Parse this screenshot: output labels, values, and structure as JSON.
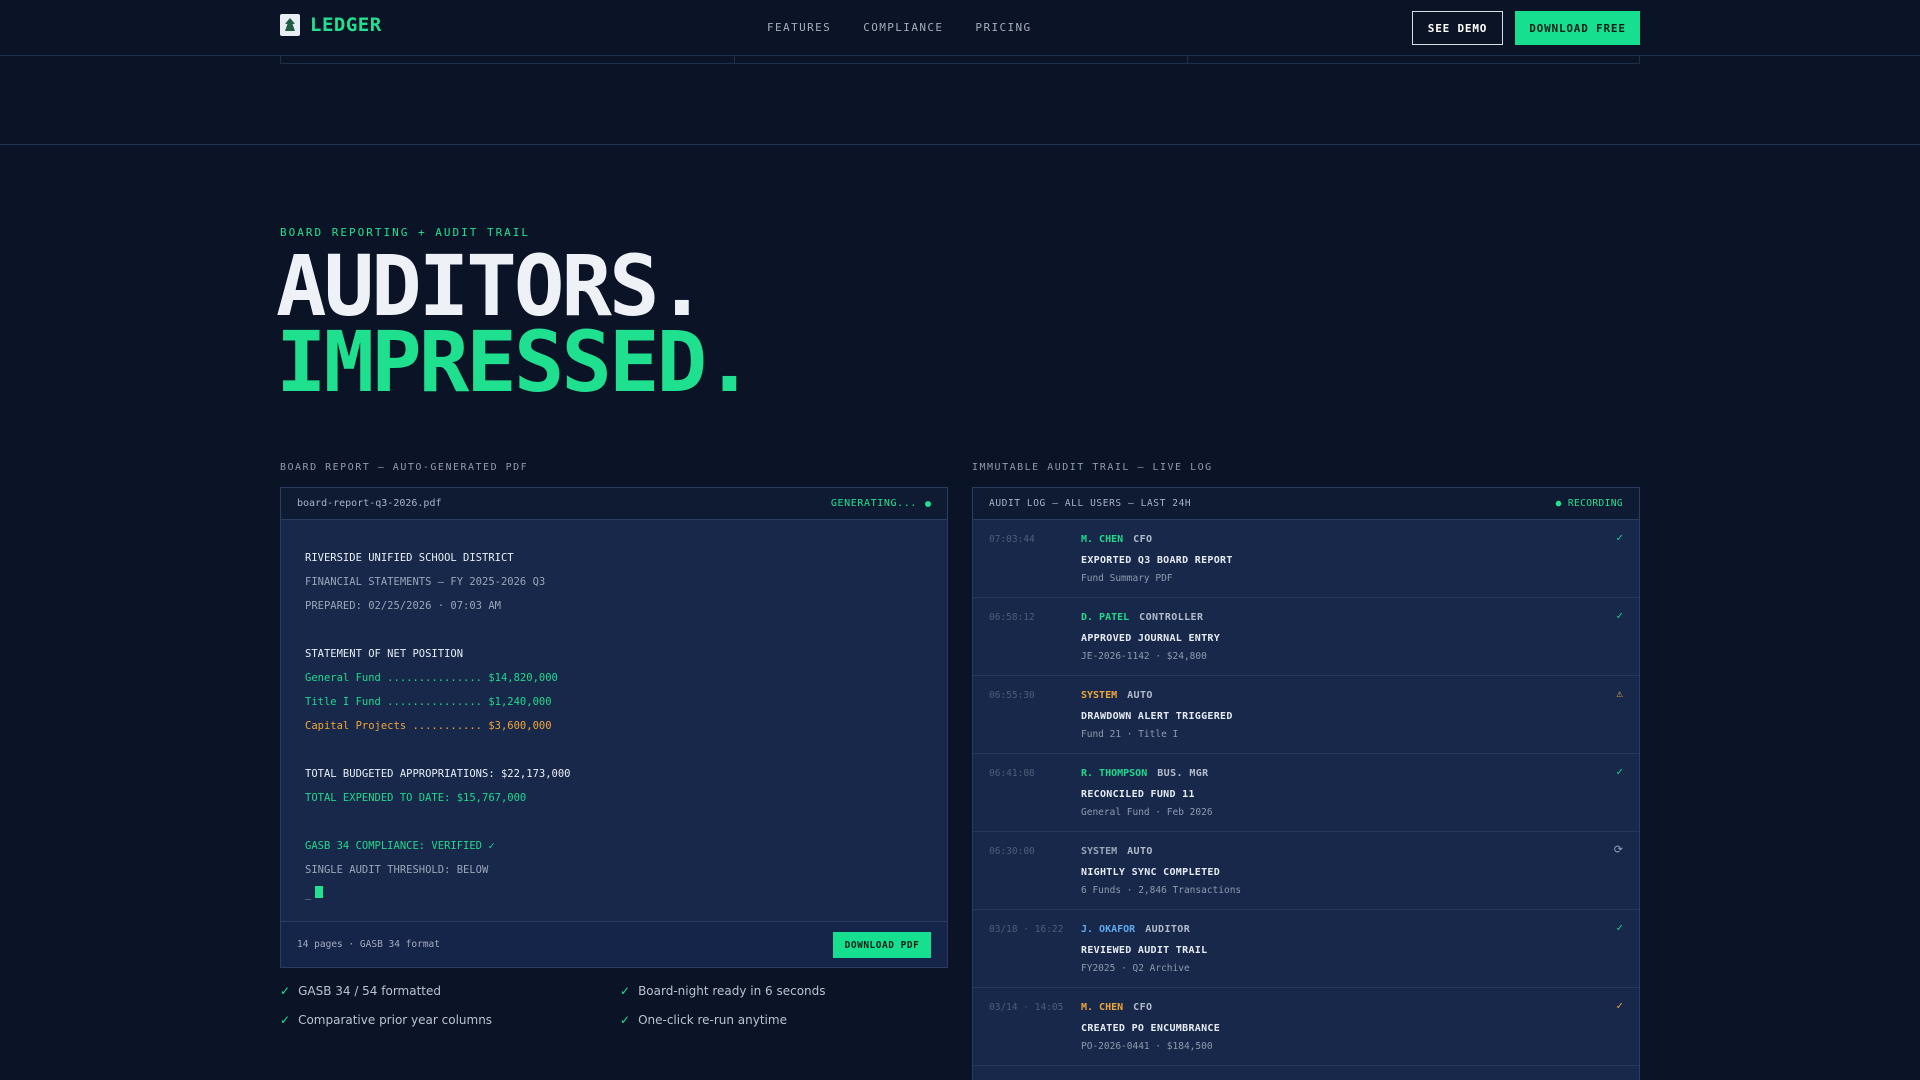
{
  "nav": {
    "brand": "LEDGER",
    "links": [
      "FEATURES",
      "COMPLIANCE",
      "PRICING"
    ],
    "see_demo": "SEE DEMO",
    "download_free": "DOWNLOAD FREE"
  },
  "hero": {
    "eyebrow": "BOARD REPORTING + AUDIT TRAIL",
    "line1": "AUDITORS.",
    "line2": "IMPRESSED."
  },
  "report": {
    "section_label": "BOARD REPORT — AUTO-GENERATED PDF",
    "filename": "board-report-q3-2026.pdf",
    "status": "GENERATING...",
    "lines": {
      "district": "RIVERSIDE UNIFIED SCHOOL DISTRICT",
      "statements": "FINANCIAL STATEMENTS — FY 2025-2026 Q3",
      "prepared": "PREPARED: 02/25/2026 · 07:03 AM",
      "net_position": "STATEMENT OF NET POSITION",
      "general_fund": "General Fund ............... $14,820,000",
      "title_i_fund": "Title I Fund ............... $1,240,000",
      "capital_projects": "Capital Projects ........... $3,600,000",
      "total_budgeted": "TOTAL BUDGETED APPROPRIATIONS: $22,173,000",
      "total_expended": "TOTAL EXPENDED TO DATE: $15,767,000",
      "gasb": "GASB 34 COMPLIANCE: VERIFIED ✓",
      "single_audit": "SINGLE AUDIT THRESHOLD: BELOW",
      "prompt": "_"
    },
    "footer_meta": "14 pages · GASB 34 format",
    "download_pdf": "DOWNLOAD PDF"
  },
  "features": [
    "GASB 34 / 54 formatted",
    "Board-night ready in 6 seconds",
    "Comparative prior year columns",
    "One-click re-run anytime"
  ],
  "audit": {
    "section_label": "IMMUTABLE AUDIT TRAIL — LIVE LOG",
    "title": "AUDIT LOG — ALL USERS — LAST 24H",
    "recording": "● RECORDING",
    "entries": [
      {
        "time": "07:03:44",
        "user": "M. CHEN",
        "role": "CFO",
        "action": "EXPORTED Q3 BOARD REPORT",
        "detail": "Fund Summary PDF",
        "icon": "✓",
        "user_color": "#22d88a",
        "icon_color": "#22d88a"
      },
      {
        "time": "06:58:12",
        "user": "D. PATEL",
        "role": "CONTROLLER",
        "action": "APPROVED JOURNAL ENTRY",
        "detail": "JE-2026-1142 · $24,800",
        "icon": "✓",
        "user_color": "#22d88a",
        "icon_color": "#22d88a"
      },
      {
        "time": "06:55:30",
        "user": "SYSTEM",
        "role": "AUTO",
        "action": "DRAWDOWN ALERT TRIGGERED",
        "detail": "Fund 21 · Title I",
        "icon": "⚠",
        "user_color": "#f0a53a",
        "icon_color": "#f0a53a"
      },
      {
        "time": "06:41:08",
        "user": "R. THOMPSON",
        "role": "BUS. MGR",
        "action": "RECONCILED FUND 11",
        "detail": "General Fund · Feb 2026",
        "icon": "✓",
        "user_color": "#22d88a",
        "icon_color": "#22d88a"
      },
      {
        "time": "06:30:00",
        "user": "SYSTEM",
        "role": "AUTO",
        "action": "NIGHTLY SYNC COMPLETED",
        "detail": "6 Funds · 2,846 Transactions",
        "icon": "⟳",
        "user_color": "#9aa6b8",
        "icon_color": "#9aa6b8"
      },
      {
        "time": "03/18 · 16:22",
        "user": "J. OKAFOR",
        "role": "AUDITOR",
        "action": "REVIEWED AUDIT TRAIL",
        "detail": "FY2025 · Q2 Archive",
        "icon": "✓",
        "user_color": "#5fa8f0",
        "icon_color": "#22d88a"
      },
      {
        "time": "03/14 · 14:05",
        "user": "M. CHEN",
        "role": "CFO",
        "action": "CREATED PO ENCUMBRANCE",
        "detail": "PO-2026-0441 · $184,500",
        "icon": "✓",
        "user_color": "#f0a53a",
        "icon_color": "#f0a53a"
      }
    ]
  }
}
